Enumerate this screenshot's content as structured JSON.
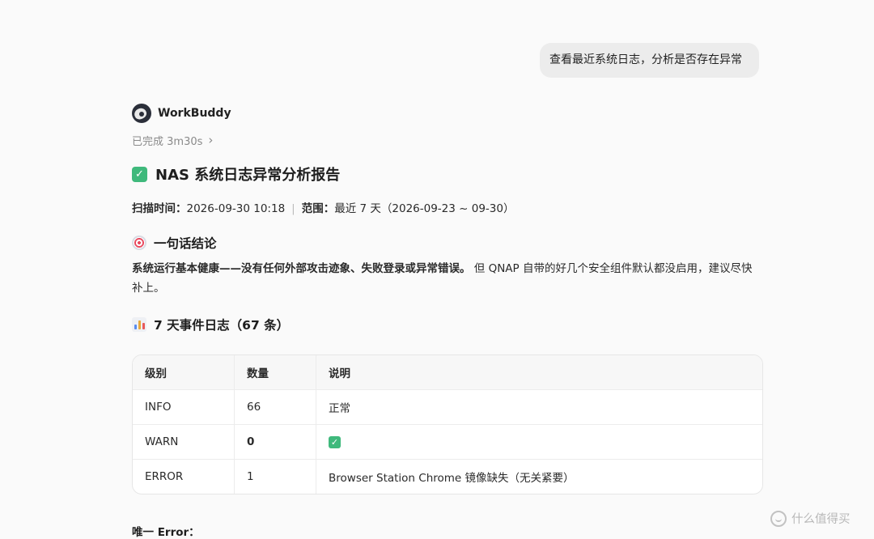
{
  "user_message": {
    "text": "查看最近系统日志，分析是否存在异常"
  },
  "agent": {
    "name": "WorkBuddy",
    "status": "已完成 3m30s"
  },
  "report": {
    "title": "NAS 系统日志异常分析报告",
    "scan_time_label": "扫描时间：",
    "scan_time_value": "2026-09-30 10:18",
    "range_label": "范围：",
    "range_value": "最近 7 天（2026-09-23 ~ 09-30）",
    "conclusion_heading": "一句话结论",
    "conclusion_bold": "系统运行基本健康——没有任何外部攻击迹象、失败登录或异常错误。",
    "conclusion_rest": " 但 QNAP 自带的好几个安全组件默认都没启用，建议尽快补上。",
    "events_heading": "7 天事件日志（67 条）",
    "table": {
      "headers": [
        "级别",
        "数量",
        "说明"
      ],
      "rows": [
        {
          "level": "INFO",
          "count": "66",
          "desc": "正常"
        },
        {
          "level": "WARN",
          "count": "0",
          "desc": ""
        },
        {
          "level": "ERROR",
          "count": "1",
          "desc": "Browser Station Chrome 镜像缺失（无关紧要）"
        }
      ]
    },
    "error_heading": "唯一 Error："
  },
  "icons": {
    "done": "check-mark-icon",
    "conclusion": "target-icon",
    "events": "bar-chart-icon"
  },
  "watermark": {
    "text": "什么值得买"
  },
  "colors": {
    "accent_green": "#3fb97c",
    "bubble_bg": "#ececec",
    "page_bg": "#fafafa"
  }
}
